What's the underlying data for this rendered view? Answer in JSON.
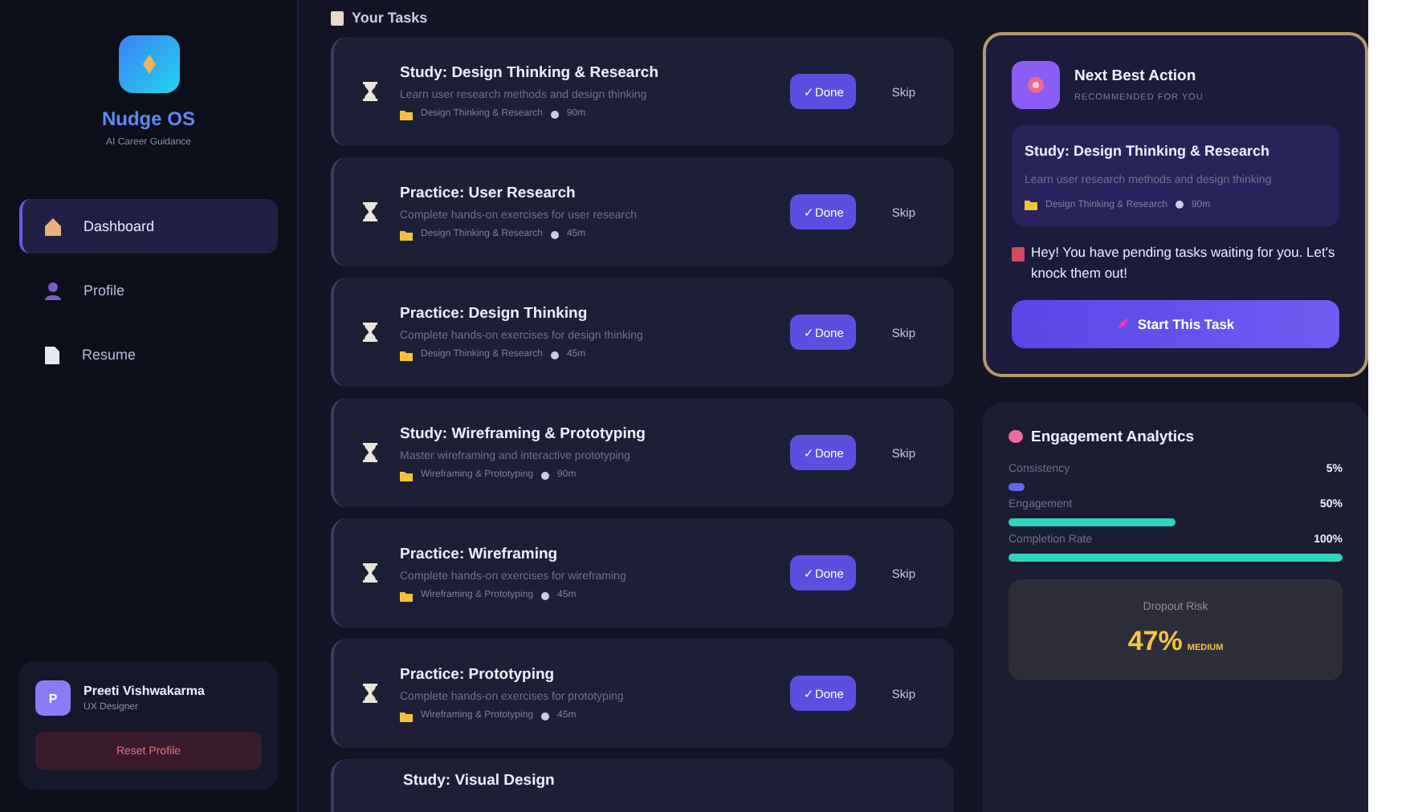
{
  "sidebar": {
    "brand": {
      "name": "Nudge OS",
      "tagline": "AI Career Guidance"
    },
    "items": [
      {
        "label": "Dashboard",
        "selected": true
      },
      {
        "label": "Profile",
        "selected": false
      },
      {
        "label": "Resume",
        "selected": false
      }
    ],
    "user": {
      "initial": "P",
      "name": "Preeti Vishwakarma",
      "role": "UX Designer",
      "button": "Reset Profile"
    }
  },
  "tasks": {
    "title": "Your Tasks",
    "items": [
      {
        "title": "Study: Design Thinking & Research",
        "description": "Learn user research methods and design thinking",
        "category": "Design Thinking & Research",
        "duration": "90m",
        "done_label": "✓Done",
        "skip_label": "Skip"
      },
      {
        "title": "Practice: User Research",
        "description": "Complete hands-on exercises for user research",
        "category": "Design Thinking & Research",
        "duration": "45m",
        "done_label": "✓Done",
        "skip_label": "Skip"
      },
      {
        "title": "Practice: Design Thinking",
        "description": "Complete hands-on exercises for design thinking",
        "category": "Design Thinking & Research",
        "duration": "45m",
        "done_label": "✓Done",
        "skip_label": "Skip"
      },
      {
        "title": "Study: Wireframing & Prototyping",
        "description": "Master wireframing and interactive prototyping",
        "category": "Wireframing & Prototyping",
        "duration": "90m",
        "done_label": "✓Done",
        "skip_label": "Skip"
      },
      {
        "title": "Practice: Wireframing",
        "description": "Complete hands-on exercises for wireframing",
        "category": "Wireframing & Prototyping",
        "duration": "45m",
        "done_label": "✓Done",
        "skip_label": "Skip"
      },
      {
        "title": "Practice: Prototyping",
        "description": "Complete hands-on exercises for prototyping",
        "category": "Wireframing & Prototyping",
        "duration": "45m",
        "done_label": "✓Done",
        "skip_label": "Skip"
      },
      {
        "title": "Study: Visual Design"
      }
    ]
  },
  "next_action": {
    "title": "Next Best Action",
    "subtitle": "RECOMMENDED FOR YOU",
    "task": {
      "title": "Study: Design Thinking & Research",
      "description": "Learn user research methods and design thinking",
      "category": "Design Thinking & Research",
      "duration": "90m"
    },
    "message": "Hey! You have pending tasks waiting for you. Let's knock them out!",
    "button": "Start This Task"
  },
  "analytics": {
    "title": "Engagement Analytics",
    "metrics": [
      {
        "label": "Consistency",
        "value": "5%",
        "level": 0.05,
        "color": "#6366f1"
      },
      {
        "label": "Engagement",
        "value": "50%",
        "level": 0.5,
        "color": "#2dd4bf"
      },
      {
        "label": "Completion Rate",
        "value": "100%",
        "level": 1.0,
        "color": "#2dd4bf"
      }
    ],
    "risk": {
      "label": "Dropout Risk",
      "value": "47%",
      "rating": "MEDIUM"
    }
  }
}
